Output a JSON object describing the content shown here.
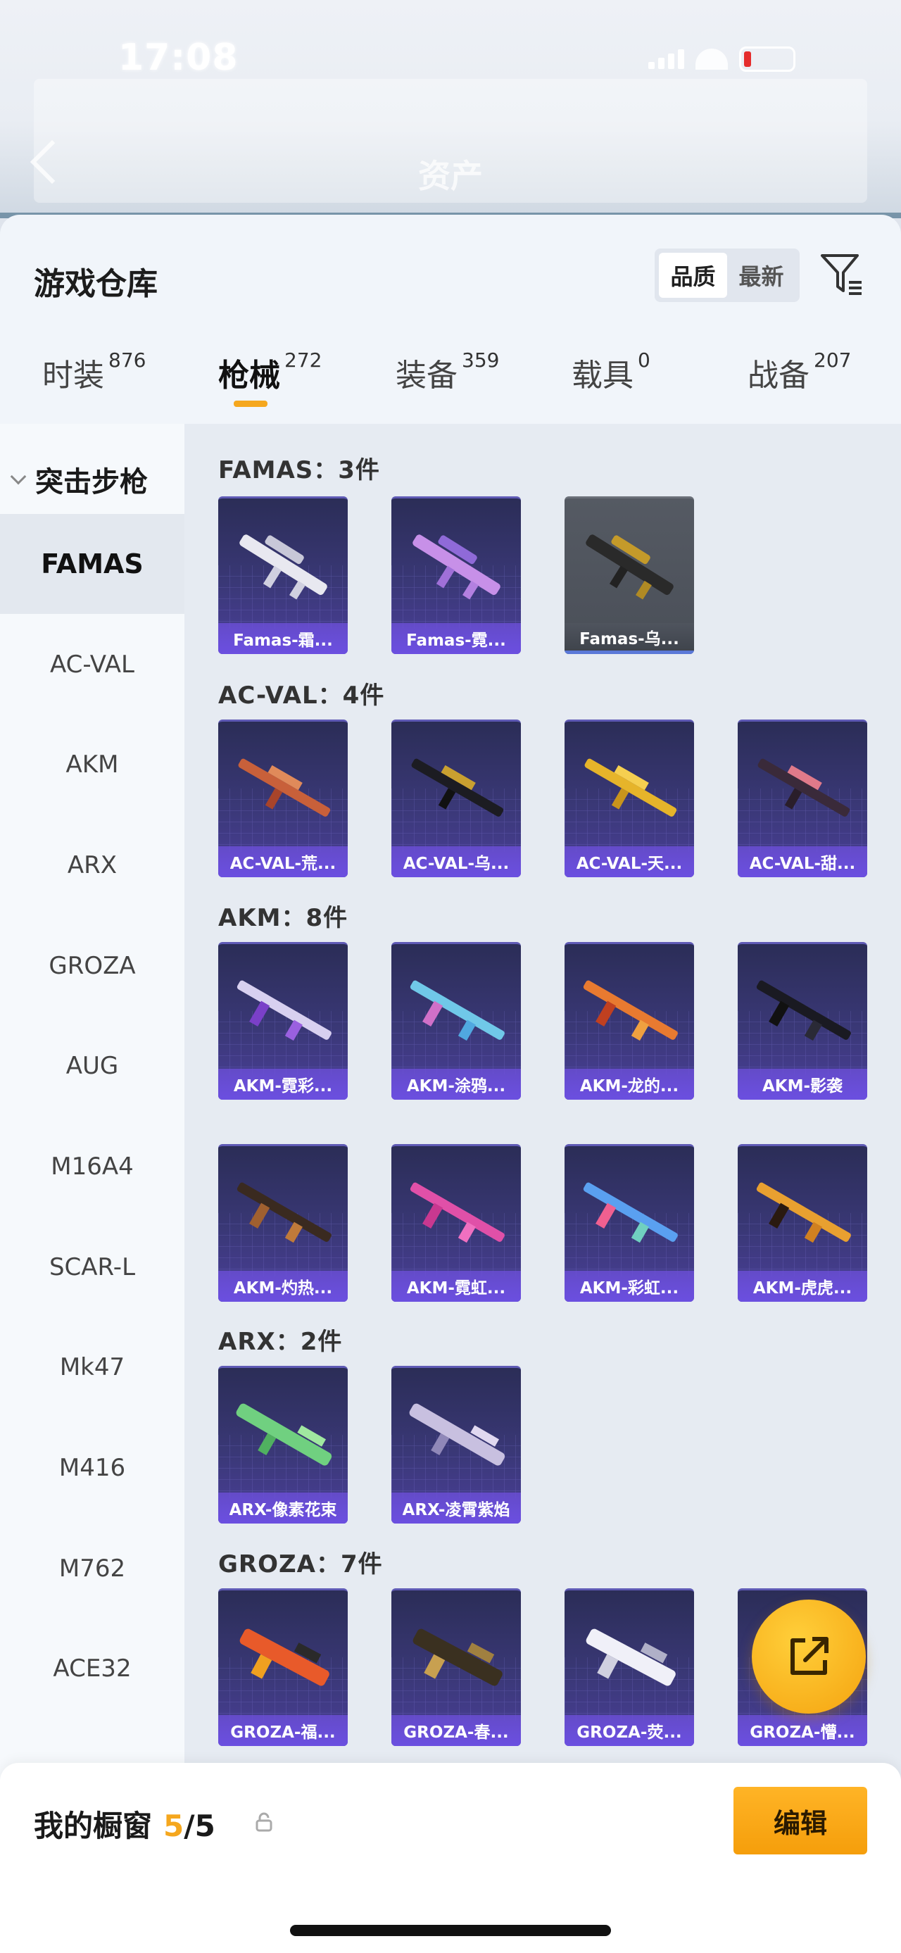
{
  "status": {
    "time": "17:08"
  },
  "nav": {
    "title": "资产"
  },
  "sheet": {
    "title": "游戏仓库"
  },
  "sort": {
    "options": [
      "品质",
      "最新"
    ],
    "active": "品质"
  },
  "tabs": [
    {
      "label": "时装",
      "count": "876"
    },
    {
      "label": "枪械",
      "count": "272"
    },
    {
      "label": "装备",
      "count": "359"
    },
    {
      "label": "载具",
      "count": "0"
    },
    {
      "label": "战备",
      "count": "207"
    }
  ],
  "sidebar": {
    "category": "突击步枪",
    "items": [
      "FAMAS",
      "AC-VAL",
      "AKM",
      "ARX",
      "GROZA",
      "AUG",
      "M16A4",
      "SCAR-L",
      "Mk47",
      "M416",
      "M762",
      "ACE32"
    ],
    "active": "FAMAS"
  },
  "groups": [
    {
      "title": "FAMAS：3件",
      "items": [
        "Famas-霜...",
        "Famas-霓...",
        "Famas-乌..."
      ]
    },
    {
      "title": "AC-VAL：4件",
      "items": [
        "AC-VAL-荒...",
        "AC-VAL-乌...",
        "AC-VAL-天...",
        "AC-VAL-甜..."
      ]
    },
    {
      "title": "AKM：8件",
      "items": [
        "AKM-霓彩...",
        "AKM-涂鸦...",
        "AKM-龙的...",
        "AKM-影袭",
        "AKM-灼热...",
        "AKM-霓虹...",
        "AKM-彩虹...",
        "AKM-虎虎..."
      ]
    },
    {
      "title": "ARX：2件",
      "items": [
        "ARX-像素花束",
        "ARX-凌霄紫焰"
      ]
    },
    {
      "title": "GROZA：7件",
      "items": [
        "GROZA-福...",
        "GROZA-春...",
        "GROZA-荧...",
        "GROZA-懵..."
      ]
    }
  ],
  "showcase": {
    "title": "我的橱窗",
    "current": "5",
    "total": "/5",
    "edit_label": "编辑"
  },
  "colors": {
    "accent": "#f5a71e",
    "card_purple": "#4b3f9a"
  }
}
